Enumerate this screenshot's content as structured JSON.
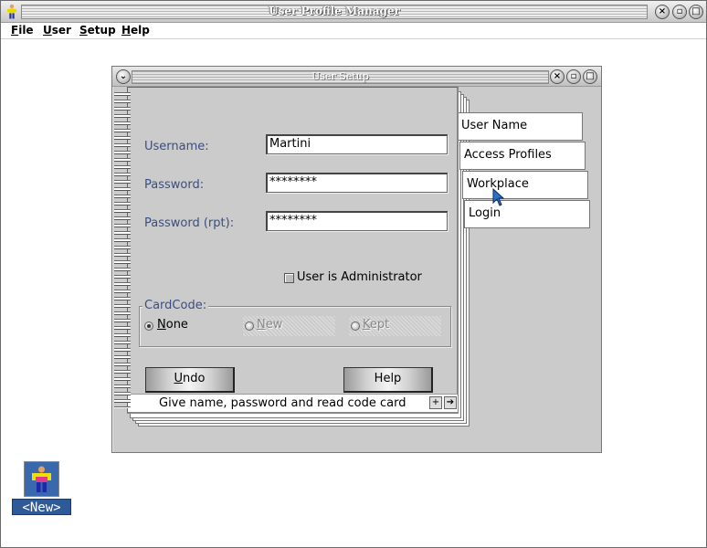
{
  "app": {
    "title": "User Profile Manager",
    "controls": {
      "close": "×",
      "minimize": "▫",
      "maximize": "□"
    }
  },
  "menu": {
    "items": [
      {
        "label": "File"
      },
      {
        "label": "User"
      },
      {
        "label": "Setup"
      },
      {
        "label": "Help"
      }
    ]
  },
  "dialog": {
    "title": "User Setup",
    "menu_glyph": "⌄",
    "fields": {
      "username": {
        "label": "Username:",
        "value": "Martini"
      },
      "password": {
        "label": "Password:",
        "value": "********"
      },
      "password_rpt": {
        "label": "Password (rpt):",
        "value": "********"
      }
    },
    "admin_checkbox": {
      "label": "User is Administrator",
      "checked": false
    },
    "cardcode": {
      "legend": "CardCode:",
      "options": [
        {
          "label": "None",
          "selected": true,
          "enabled": true
        },
        {
          "label": "New",
          "selected": false,
          "enabled": false
        },
        {
          "label": "Kept",
          "selected": false,
          "enabled": false
        }
      ]
    },
    "buttons": {
      "undo": "Undo",
      "help": "Help"
    },
    "status": {
      "text": "Give name, password and read code card",
      "next_glyph": "+",
      "arrow_glyph": "➔"
    },
    "tabs": [
      {
        "label": "User Name"
      },
      {
        "label": "Access Profiles"
      },
      {
        "label": "Workplace"
      },
      {
        "label": "Login"
      }
    ]
  },
  "desktop": {
    "icon_label": "<New>"
  },
  "colors": {
    "label_blue": "#3a4e86",
    "desktop_icon_bg": "#2e5a99",
    "dialog_bg": "#cbcbcb"
  }
}
